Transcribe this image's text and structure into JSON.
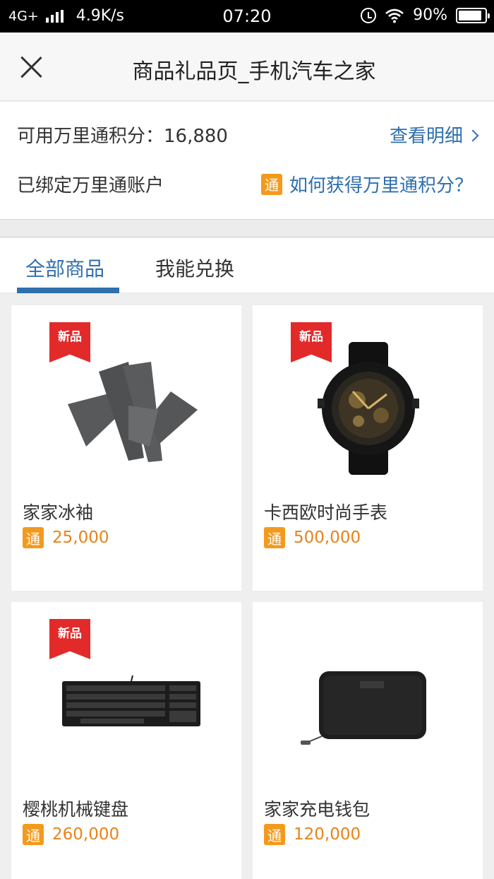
{
  "status_bar": {
    "network": "4G+",
    "speed": "4.9K/s",
    "time": "07:20",
    "battery": "90%"
  },
  "nav": {
    "title": "商品礼品页_手机汽车之家"
  },
  "points": {
    "label": "可用万里通积分：16,880",
    "detail_link": "查看明细",
    "bound_text": "已绑定万里通账户",
    "badge": "通",
    "howto_link": "如何获得万里通积分？"
  },
  "tabs": [
    {
      "label": "全部商品",
      "active": true
    },
    {
      "label": "我能兑换",
      "active": false
    }
  ],
  "products": [
    {
      "name": "家家冰袖",
      "price": "25,000",
      "badge": "通",
      "tag": "新品",
      "image": "arm-sleeves-image"
    },
    {
      "name": "卡西欧时尚手表",
      "price": "500,000",
      "badge": "通",
      "tag": "新品",
      "image": "watch-image"
    },
    {
      "name": "樱桃机械键盘",
      "price": "260,000",
      "badge": "通",
      "tag": "新品",
      "image": "keyboard-image"
    },
    {
      "name": "家家充电钱包",
      "price": "120,000",
      "badge": "通",
      "tag": "",
      "image": "wallet-image"
    }
  ],
  "colors": {
    "accent": "#2f6fae",
    "price": "#e8831a",
    "badge": "#f39a1e",
    "new_tag": "#e22a2a"
  }
}
